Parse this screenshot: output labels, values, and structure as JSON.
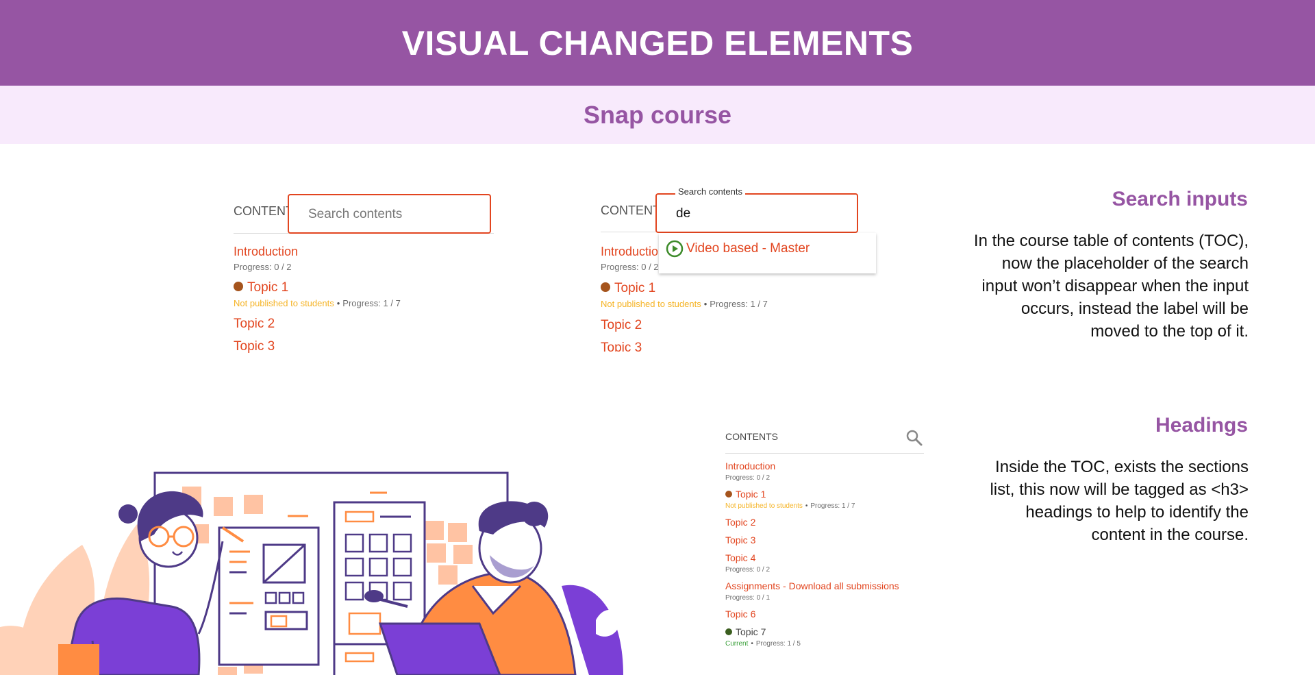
{
  "header": {
    "title": "VISUAL CHANGED ELEMENTS"
  },
  "subheader": {
    "title": "Snap course"
  },
  "screenshot_a": {
    "toc_title": "CONTENTS",
    "search_placeholder": "Search contents",
    "items": [
      {
        "label": "Introduction",
        "progress": "Progress: 0 / 2"
      },
      {
        "label": "Topic 1",
        "status": "Not published to students",
        "progress": "Progress: 1 / 7",
        "dot_color": "#a5541d"
      },
      {
        "label": "Topic 2"
      },
      {
        "label": "Topic 3"
      }
    ]
  },
  "screenshot_b": {
    "toc_title": "CONTENTS",
    "search_label": "Search contents",
    "search_value": "de",
    "result_label": "Video based - Master",
    "items": [
      {
        "label": "Introduction",
        "progress": "Progress: 0 / 2"
      },
      {
        "label": "Topic 1",
        "status": "Not published to students",
        "progress": "Progress: 1 / 7",
        "dot_color": "#a5541d"
      },
      {
        "label": "Topic 2"
      },
      {
        "label": "Topic 3"
      }
    ]
  },
  "screenshot_c": {
    "toc_title": "CONTENTS",
    "items": [
      {
        "label": "Introduction",
        "progress": "Progress: 0 / 2"
      },
      {
        "label": "Topic 1",
        "status": "Not published to students",
        "progress": "Progress: 1 / 7",
        "dot_color": "#a5541d"
      },
      {
        "label": "Topic 2"
      },
      {
        "label": "Topic 3"
      },
      {
        "label": "Topic 4",
        "progress": "Progress: 0 / 2"
      },
      {
        "label": "Assignments - Download all submissions",
        "progress": "Progress: 0 / 1"
      },
      {
        "label": "Topic 6"
      },
      {
        "label": "Topic 7",
        "status": "Current",
        "progress": "Progress: 1 / 5",
        "dot_color": "#3b5e1f"
      }
    ]
  },
  "sections": [
    {
      "heading": "Search inputs",
      "lines": [
        "In the course table of contents (TOC),",
        "now the placeholder of the search",
        "input won’t disappear when the input",
        "occurs, instead the label will be",
        "moved to the top of it."
      ]
    },
    {
      "heading": "Headings",
      "lines": [
        "Inside the TOC, exists the sections",
        "list, this now will be tagged as <h3>",
        "headings to help to identify the",
        "content in the course."
      ]
    }
  ],
  "colors": {
    "brand_purple": "#9655a3",
    "light_purple": "#f8eafc",
    "link_red": "#e2451f",
    "orange": "#ff8c42",
    "violet": "#7b3fd6"
  },
  "icons": [
    "search-icon",
    "play-circle-icon"
  ]
}
